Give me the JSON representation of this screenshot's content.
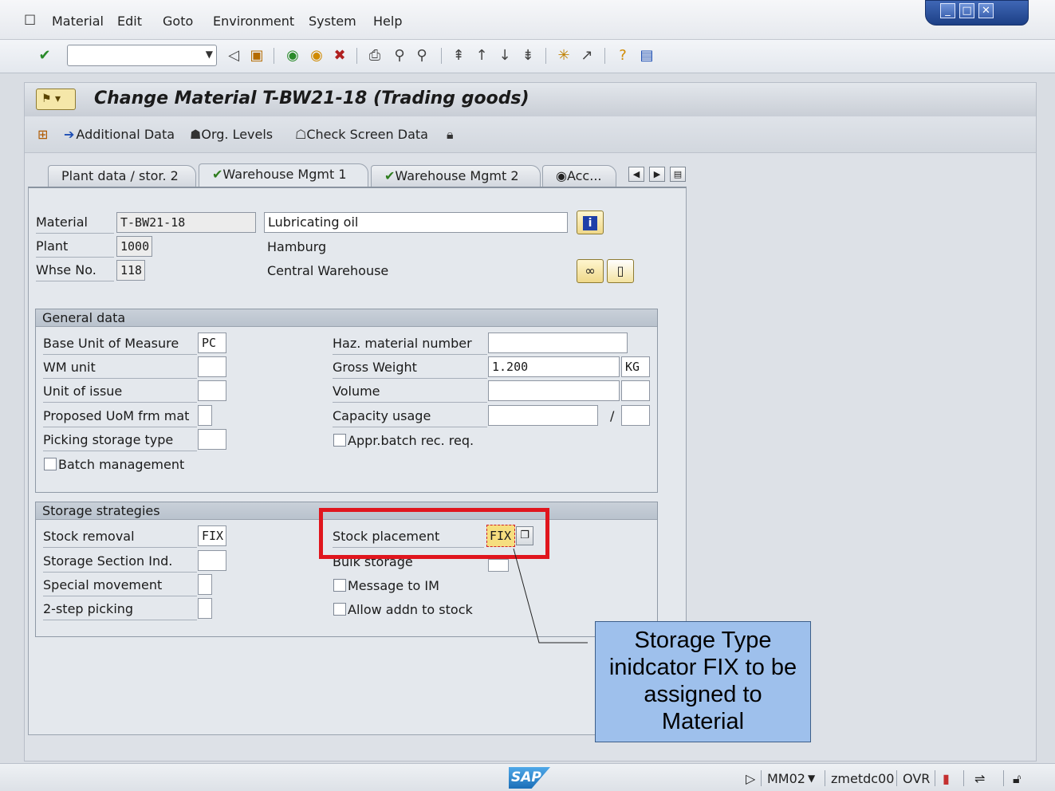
{
  "menubar": {
    "items": [
      "Material",
      "Edit",
      "Goto",
      "Environment",
      "System",
      "Help"
    ]
  },
  "window": {
    "minimize": "_",
    "maximize": "□",
    "close": "✕"
  },
  "toolbar": {
    "command_value": "",
    "icons": [
      "enter-icon",
      "back-icon",
      "save-icon",
      "exit-icon",
      "cancel-icon",
      "print-icon",
      "find-icon",
      "find-next-icon",
      "first-page-icon",
      "prev-page-icon",
      "next-page-icon",
      "last-page-icon",
      "create-session-icon",
      "shortcut-icon",
      "help-icon",
      "layout-icon"
    ]
  },
  "header": {
    "title": "Change Material T-BW21-18 (Trading goods)"
  },
  "appbar": {
    "additional_data": "Additional Data",
    "org_levels": "Org. Levels",
    "check_screen_data": "Check Screen Data"
  },
  "tabs": [
    {
      "label": "Plant data / stor. 2"
    },
    {
      "label": "Warehouse Mgmt 1"
    },
    {
      "label": "Warehouse Mgmt 2"
    },
    {
      "label": "Acc..."
    }
  ],
  "header_fields": {
    "material_label": "Material",
    "material_value": "T-BW21-18",
    "material_desc": "Lubricating oil",
    "plant_label": "Plant",
    "plant_value": "1000",
    "plant_desc": "Hamburg",
    "whse_label": "Whse No.",
    "whse_value": "118",
    "whse_desc": "Central Warehouse"
  },
  "general": {
    "title": "General data",
    "base_uom_label": "Base Unit of Measure",
    "base_uom_value": "PC",
    "wm_unit_label": "WM unit",
    "unit_issue_label": "Unit of issue",
    "proposed_uom_label": "Proposed UoM frm mat",
    "picking_type_label": "Picking storage type",
    "batch_mgmt_label": "Batch management",
    "haz_label": "Haz. material number",
    "gross_weight_label": "Gross Weight",
    "gross_weight_value": "1.200",
    "gross_weight_unit": "KG",
    "volume_label": "Volume",
    "capacity_label": "Capacity usage",
    "capacity_sep": "/",
    "appr_batch_label": "Appr.batch rec. req."
  },
  "strategies": {
    "title": "Storage strategies",
    "stock_removal_label": "Stock removal",
    "stock_removal_value": "FIX",
    "section_ind_label": "Storage Section Ind.",
    "special_movement_label": "Special movement",
    "two_step_label": "2-step picking",
    "stock_placement_label": "Stock placement",
    "stock_placement_value": "FIX",
    "bulk_storage_label": "Bulk storage",
    "message_im_label": "Message to IM",
    "allow_addn_label": "Allow addn to stock"
  },
  "callout": {
    "line1": "Storage Type",
    "line2": "inidcator FIX to be",
    "line3": "assigned to",
    "line4": "Material"
  },
  "statusbar": {
    "logo": "SAP",
    "transaction": "MM02",
    "server": "zmetdc00",
    "mode": "OVR"
  },
  "colors": {
    "highlight": "#e0151d",
    "callout_bg": "#9ec0ec",
    "input_highlight": "#f6de7f"
  }
}
